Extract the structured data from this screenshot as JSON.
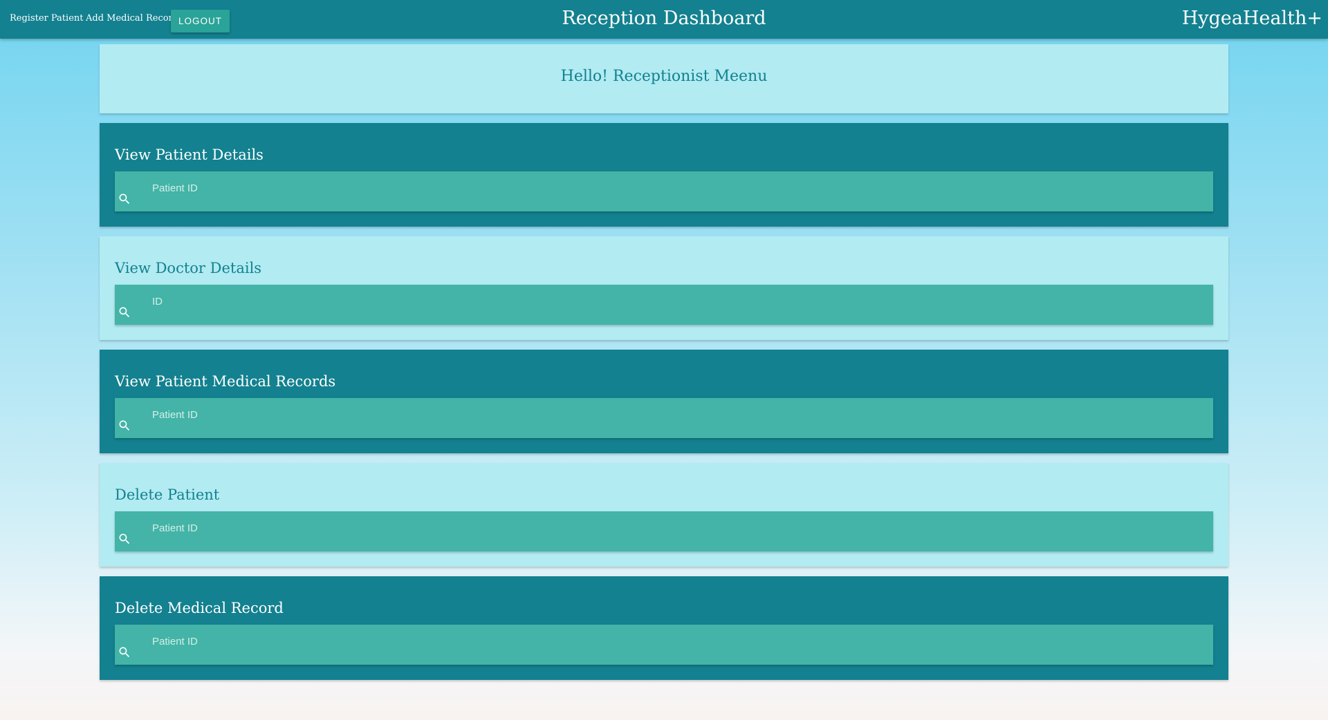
{
  "nav": {
    "links": [
      "Register Patient",
      "Add Medical Record"
    ],
    "logout_label": "LOGOUT",
    "title": "Reception Dashboard",
    "brand": "HygeaHealth+"
  },
  "greeting": "Hello! Receptionist Meenu",
  "cards": [
    {
      "title": "View Patient Details",
      "placeholder": "Patient ID",
      "style": "dark",
      "icon": "search-icon"
    },
    {
      "title": "View Doctor Details",
      "placeholder": "ID",
      "style": "light",
      "icon": "search-icon"
    },
    {
      "title": "View Patient Medical Records",
      "placeholder": "Patient ID",
      "style": "dark",
      "icon": "search-icon"
    },
    {
      "title": "Delete Patient",
      "placeholder": "Patient ID",
      "style": "light",
      "icon": "search-icon"
    },
    {
      "title": "Delete Medical Record",
      "placeholder": "Patient ID",
      "style": "dark",
      "icon": "search-icon"
    }
  ],
  "colors": {
    "primary": "#13818f",
    "search_field": "#43b4a7",
    "light_card": "#b2ebf2",
    "logout_button": "#2aa398"
  }
}
